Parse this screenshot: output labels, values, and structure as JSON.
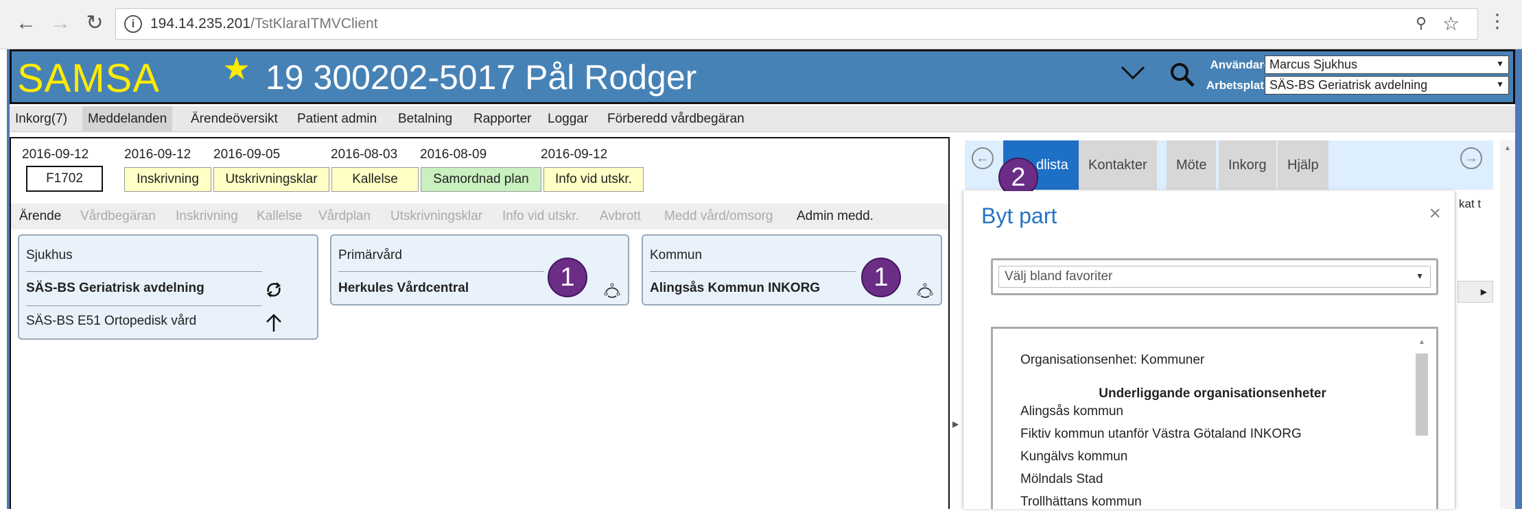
{
  "browser": {
    "back_icon": "arrow-left-icon",
    "forward_icon": "arrow-right-icon",
    "reload_icon": "reload-icon",
    "url_host": "194.14.235.201",
    "url_path": "/TstKlaraITMVClient"
  },
  "header": {
    "logo": "SAMSA",
    "patient": "19 300202-5017 Pål Rodger",
    "user_label": "Användare:",
    "user_value": "Marcus Sjukhus",
    "workplace_label": "Arbetsplats:",
    "workplace_value": "SÄS-BS Geriatrisk avdelning",
    "accent": "#ffeb00",
    "bar_color": "#4782b6"
  },
  "top_menu": [
    "Inkorg(7)",
    "Meddelanden",
    "Ärendeöversikt",
    "Patient admin",
    "Betalning",
    "Rapporter",
    "Loggar",
    "Förberedd vårdbegäran"
  ],
  "case": {
    "case_date": "2016-09-12",
    "case_id": "F1702",
    "statuses": [
      {
        "date": "2016-09-12",
        "label": "Inskrivning"
      },
      {
        "date": "2016-09-05",
        "label": "Utskrivningsklar"
      },
      {
        "date": "2016-08-03",
        "label": "Kallelse"
      },
      {
        "date": "2016-08-09",
        "label": "Samordnad plan"
      },
      {
        "date": "2016-09-12",
        "label": "Info vid utskr."
      }
    ]
  },
  "sub_menu": [
    "Ärende",
    "Vårdbegäran",
    "Inskrivning",
    "Kallelse",
    "Vårdplan",
    "Utskrivningsklar",
    "Info vid utskr.",
    "Avbrott",
    "Medd vård/omsorg",
    "Admin medd."
  ],
  "cards": {
    "hospital": {
      "title": "Sjukhus",
      "value": "SÄS-BS Geriatrisk avdelning",
      "value2": "SÄS-BS E51 Ortopedisk vård"
    },
    "primary": {
      "title": "Primärvård",
      "value": "Herkules Vårdcentral",
      "badge": "1"
    },
    "municipality": {
      "title": "Kommun",
      "value": "Alingsås Kommun INKORG",
      "badge": "1"
    }
  },
  "right_tabs": {
    "active": "dlista",
    "tabs": [
      "Kontakter",
      "Möte",
      "Inkorg",
      "Hjälp"
    ],
    "badge": "2",
    "clipped_text": "kat t"
  },
  "dialog": {
    "title": "Byt part",
    "close": "×",
    "favorites_placeholder": "Välj bland favoriter",
    "org_label": "Organisationsenhet: Kommuner",
    "sub_heading": "Underliggande organisationsenheter",
    "orgs": [
      "Alingsås kommun",
      "Fiktiv kommun utanför Västra Götaland INKORG",
      "Kungälvs kommun",
      "Mölndals Stad",
      "Trollhättans kommun"
    ]
  }
}
